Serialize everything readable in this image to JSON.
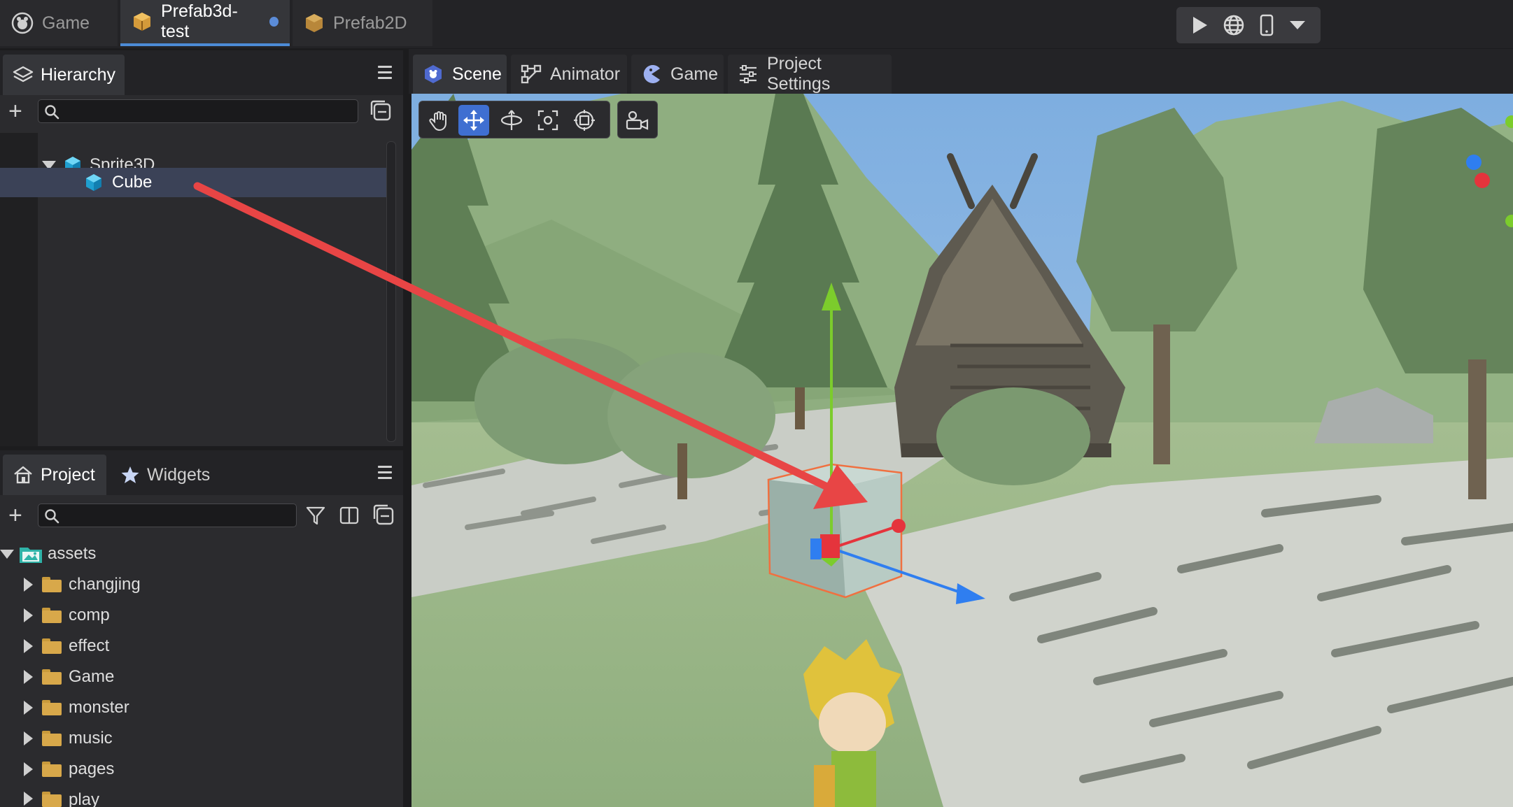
{
  "doc_tabs": [
    {
      "label": "Game",
      "icon": "engine-logo-icon"
    },
    {
      "label": "Prefab3d-test",
      "icon": "prefab-box-icon",
      "active": true,
      "modified": true
    },
    {
      "label": "Prefab2D",
      "icon": "prefab-box-icon"
    }
  ],
  "run_controls": {
    "icons": [
      "play-icon",
      "globe-icon",
      "mobile-device-icon",
      "dropdown-arrow-icon"
    ]
  },
  "hierarchy": {
    "tab_label": "Hierarchy",
    "search_placeholder": "",
    "nodes": [
      {
        "label": "Sprite3D",
        "expanded": true,
        "icon": "cube-3d-icon"
      },
      {
        "label": "Cube",
        "selected": true,
        "icon": "cube-3d-icon"
      }
    ]
  },
  "project": {
    "tabs": [
      {
        "label": "Project",
        "icon": "home-icon",
        "active": true
      },
      {
        "label": "Widgets",
        "icon": "star-icon"
      }
    ],
    "search_placeholder": "",
    "root": {
      "label": "assets",
      "expanded": true
    },
    "folders": [
      "changjing",
      "comp",
      "effect",
      "Game",
      "monster",
      "music",
      "pages",
      "play"
    ]
  },
  "scene_tabs": [
    {
      "label": "Scene",
      "icon": "scene-icon",
      "active": true
    },
    {
      "label": "Animator",
      "icon": "animator-icon"
    },
    {
      "label": "Game",
      "icon": "game-pacman-icon"
    },
    {
      "label": "Project Settings",
      "icon": "sliders-icon"
    }
  ],
  "scene_tools": [
    "hand-pan-icon",
    "move-tool-icon",
    "rotate-tool-icon",
    "scale-tool-icon",
    "rect-tool-icon",
    "camera-icon"
  ],
  "active_tool": "move-tool-icon",
  "colors": {
    "accent": "#3f6fd1",
    "selection": "#3b4257",
    "annotation_arrow": "#e84545",
    "gizmo_x": "#e5343c",
    "gizmo_y": "#7ccc2c",
    "gizmo_z": "#2f7ef0",
    "sky": "#8ab7e6",
    "ground": "#9db88a"
  }
}
